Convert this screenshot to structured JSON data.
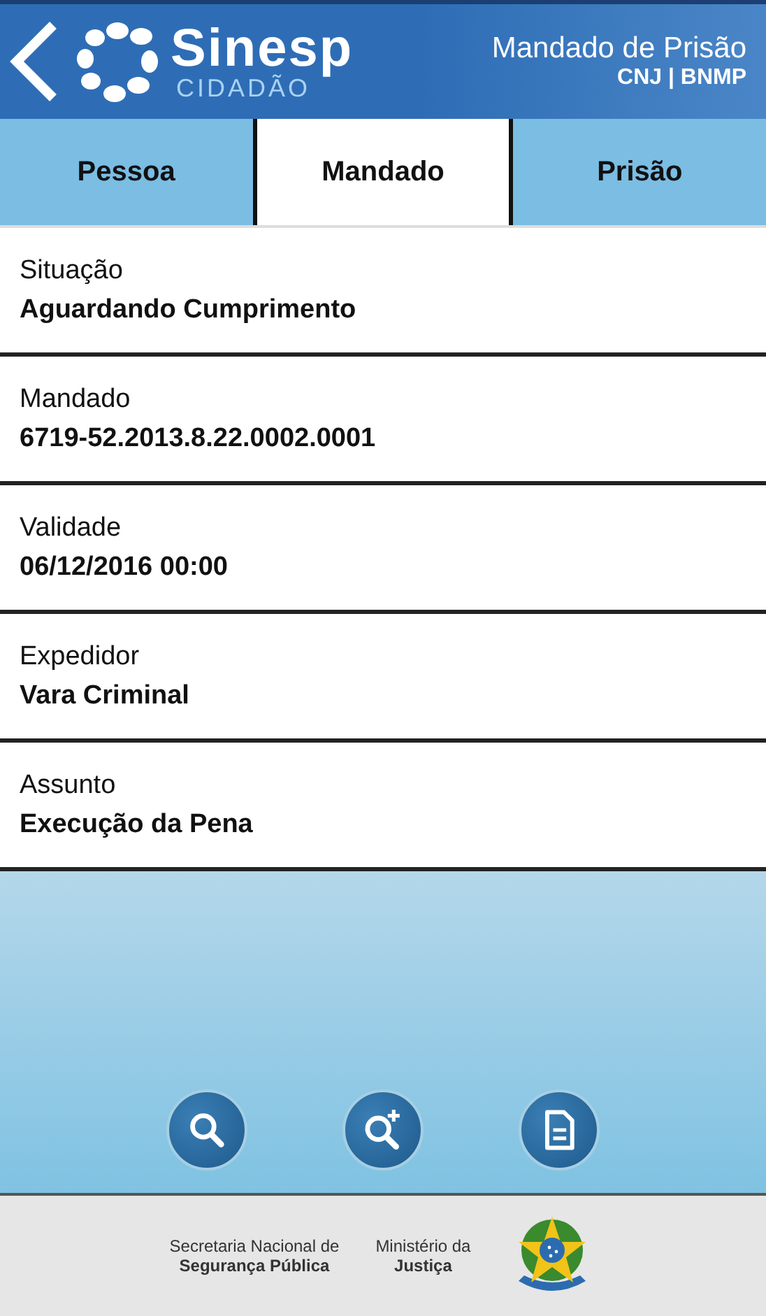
{
  "header": {
    "logo_name": "Sinesp",
    "logo_sub": "CIDADÃO",
    "title": "Mandado de Prisão",
    "subtitle": "CNJ | BNMP"
  },
  "tabs": [
    {
      "label": "Pessoa",
      "selected": false
    },
    {
      "label": "Mandado",
      "selected": true
    },
    {
      "label": "Prisão",
      "selected": false
    }
  ],
  "fields": [
    {
      "label": "Situação",
      "value": "Aguardando Cumprimento"
    },
    {
      "label": "Mandado",
      "value": "6719-52.2013.8.22.0002.0001"
    },
    {
      "label": "Validade",
      "value": "06/12/2016 00:00"
    },
    {
      "label": "Expedidor",
      "value": "Vara Criminal"
    },
    {
      "label": "Assunto",
      "value": "Execução da Pena"
    }
  ],
  "actions": [
    {
      "kind": "search"
    },
    {
      "kind": "search-plus"
    },
    {
      "kind": "document"
    }
  ],
  "footer": {
    "secretaria_line1": "Secretaria Nacional de",
    "secretaria_line2": "Segurança Pública",
    "ministerio_line1": "Ministério da",
    "ministerio_line2": "Justiça"
  }
}
